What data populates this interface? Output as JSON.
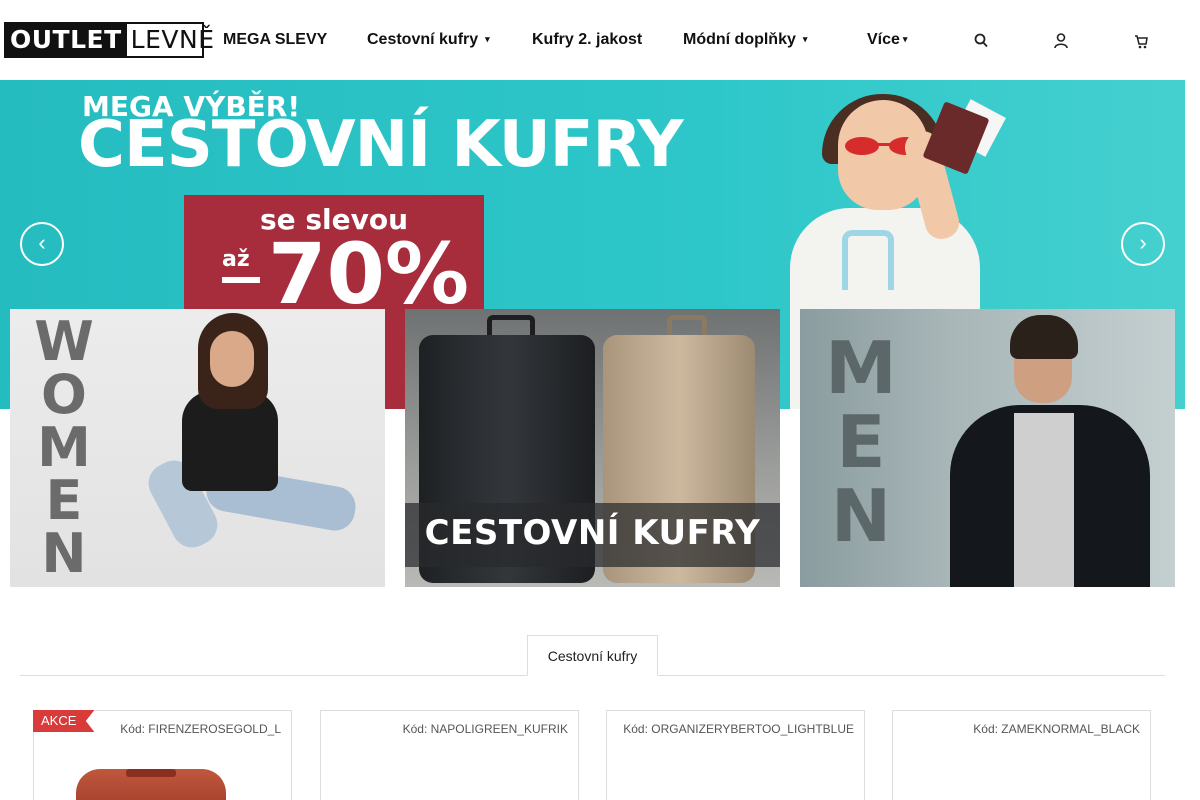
{
  "brand": {
    "part1": "OUTLET",
    "part2": "LEVNĚ"
  },
  "nav": [
    {
      "label": "MEGA SLEVY",
      "has_dropdown": false
    },
    {
      "label": "Cestovní kufry",
      "has_dropdown": true
    },
    {
      "label": "Kufry 2. jakost",
      "has_dropdown": false
    },
    {
      "label": "Módní doplňky",
      "has_dropdown": true
    },
    {
      "label": "Více",
      "has_dropdown": true
    }
  ],
  "header_icons": [
    "search-icon",
    "user-icon",
    "cart-icon"
  ],
  "banner": {
    "kicker": "MEGA VÝBĚR!",
    "headline": "CESTOVNÍ KUFRY",
    "promo_line1": "se slevou",
    "promo_line2": "až",
    "promo_value": "70%",
    "prev_icon": "chevron-left-icon",
    "next_icon": "chevron-right-icon",
    "colors": {
      "background": "#2ec7c9",
      "promo": "#a72d3d"
    }
  },
  "tiles": {
    "women_letters": [
      "W",
      "O",
      "M",
      "E",
      "N"
    ],
    "kufry_label": "CESTOVNÍ KUFRY",
    "men_letters": [
      "M",
      "E",
      "N"
    ]
  },
  "tab": {
    "label": "Cestovní kufry"
  },
  "products": [
    {
      "badge": "AKCE",
      "code": "Kód: FIRENZEROSEGOLD_L"
    },
    {
      "badge": "",
      "code": "Kód: NAPOLIGREEN_KUFRIK"
    },
    {
      "badge": "",
      "code": "Kód: ORGANIZERYBERTOO_LIGHTBLUE"
    },
    {
      "badge": "",
      "code": "Kód: ZAMEKNORMAL_BLACK"
    }
  ],
  "colors": {
    "badge": "#d93a3a",
    "border": "#dddddd"
  }
}
